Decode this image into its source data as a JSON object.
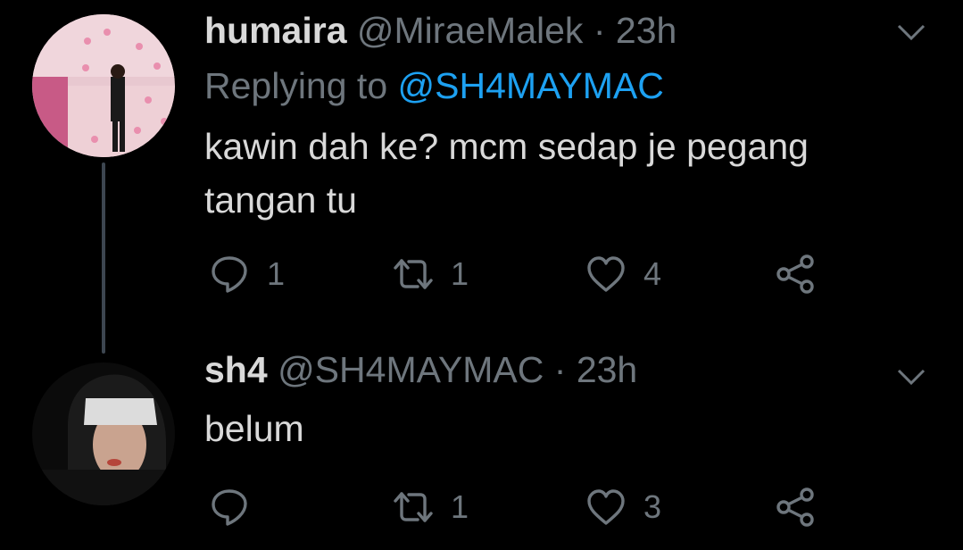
{
  "tweets": [
    {
      "name": "humaira",
      "handle": "@MiraeMalek",
      "separator": "·",
      "time": "23h",
      "replying_label": "Replying to",
      "replying_handle": "@SH4MAYMAC",
      "text": "kawin dah ke? mcm sedap je pegang tangan tu",
      "reply_count": "1",
      "retweet_count": "1",
      "like_count": "4"
    },
    {
      "name": "sh4",
      "handle": "@SH4MAYMAC",
      "separator": "·",
      "time": "23h",
      "text": "belum",
      "reply_count": "",
      "retweet_count": "1",
      "like_count": "3"
    }
  ],
  "colors": {
    "background": "#000000",
    "text": "#d9d9d9",
    "secondary": "#6e767d",
    "link": "#1da1f2",
    "thread_line": "#3d4650"
  },
  "icons": {
    "reply": "speech-bubble-icon",
    "retweet": "retweet-arrows-icon",
    "like": "heart-icon",
    "share": "share-nodes-icon",
    "more": "chevron-down-icon"
  }
}
